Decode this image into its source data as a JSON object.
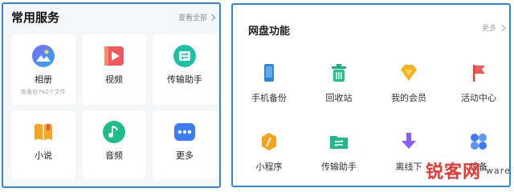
{
  "common_services": {
    "title": "常用服务",
    "view_all": "查看全部",
    "items": [
      {
        "label": "相册",
        "sub": "新备份742个文件",
        "icon": "album-icon"
      },
      {
        "label": "视频",
        "icon": "video-icon"
      },
      {
        "label": "传输助手",
        "icon": "transfer-icon"
      },
      {
        "label": "小说",
        "icon": "novel-icon"
      },
      {
        "label": "音频",
        "icon": "audio-icon"
      },
      {
        "label": "更多",
        "icon": "more-dots-icon"
      }
    ]
  },
  "netdisk_functions": {
    "title": "网盘功能",
    "more": "更多",
    "items": [
      {
        "label": "手机备份",
        "icon": "phone-backup-icon"
      },
      {
        "label": "回收站",
        "icon": "recycle-bin-icon"
      },
      {
        "label": "我的会员",
        "icon": "membership-icon"
      },
      {
        "label": "活动中心",
        "icon": "activity-flag-icon"
      },
      {
        "label": "小程序",
        "icon": "mini-program-icon"
      },
      {
        "label": "传输助手",
        "icon": "transfer-folder-icon"
      },
      {
        "label": "离线下",
        "icon": "offline-download-icon"
      },
      {
        "label": "设备",
        "icon": "device-icon"
      }
    ]
  },
  "watermark": {
    "text": "锐客网",
    "suffix": "ware"
  },
  "colors": {
    "border": "#2f86d4",
    "panel_bg": "#f5f6f8",
    "green": "#22b573",
    "orange": "#f6b11c",
    "red": "#ef4444",
    "purple": "#8b5cf6",
    "blue": "#2f86d4"
  }
}
